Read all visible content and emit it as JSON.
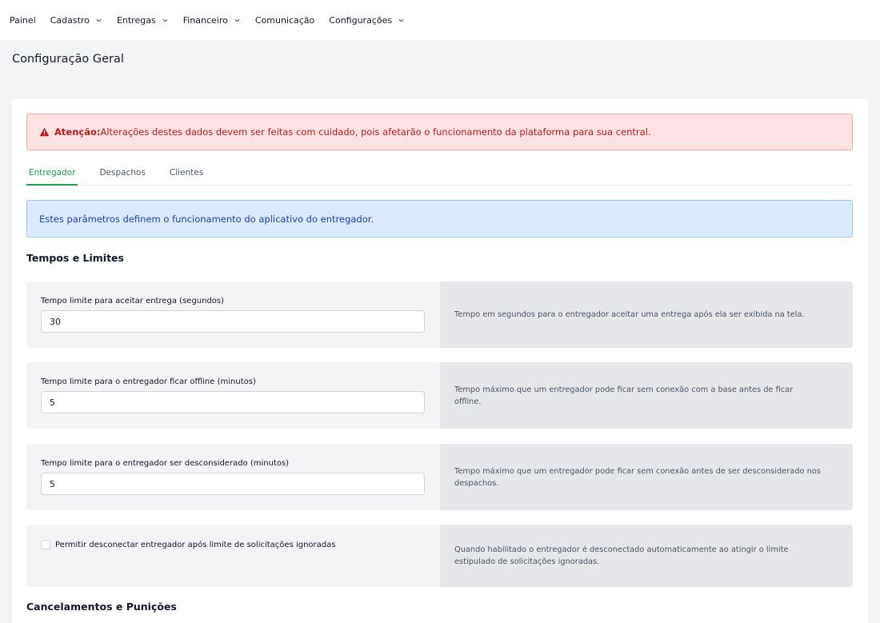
{
  "nav": {
    "items": [
      {
        "label": "Painel",
        "has_dropdown": false
      },
      {
        "label": "Cadastro",
        "has_dropdown": true
      },
      {
        "label": "Entregas",
        "has_dropdown": true
      },
      {
        "label": "Financeiro",
        "has_dropdown": true
      },
      {
        "label": "Comunicação",
        "has_dropdown": false
      },
      {
        "label": "Configurações",
        "has_dropdown": true
      }
    ]
  },
  "page": {
    "title": "Configuração Geral"
  },
  "alert": {
    "strong": "Atenção:",
    "text": "Alterações destes dados devem ser feitas com cuidado, pois afetarão o funcionamento da plataforma para sua central.",
    "icon": "warning-triangle-icon",
    "color": "#b91c1c"
  },
  "tabs": [
    {
      "label": "Entregador",
      "active": true
    },
    {
      "label": "Despachos",
      "active": false
    },
    {
      "label": "Clientes",
      "active": false
    }
  ],
  "info": {
    "text": "Estes parâmetros definem o funcionamento do aplicativo do entregador."
  },
  "sections": {
    "limits_title": "Tempos e Limites",
    "cancel_title": "Cancelamentos e Punições"
  },
  "fields": [
    {
      "label": "Tempo limite para aceitar entrega (segundos)",
      "value": "30",
      "help": "Tempo em segundos para o entregador aceitar uma entrega após ela ser exibida na tela."
    },
    {
      "label": "Tempo limite para o entregador ficar offline (minutos)",
      "value": "5",
      "help": "Tempo máximo que um entregador pode ficar sem conexão com a base antes de ficar offline."
    },
    {
      "label": "Tempo limite para o entregador ser desconsiderado (minutos)",
      "value": "5",
      "help": "Tempo máximo que um entregador pode ficar sem conexão antes de ser desconsiderado nos despachos."
    }
  ],
  "checkbox": {
    "label": "Permitir desconectar entregador após limite de solicitações ignoradas",
    "checked": false,
    "help": "Quando habilitado o entregador é desconectado automaticamente ao atingir o limite estipulado de solicitações ignoradas."
  },
  "colors": {
    "accent": "#16a34a",
    "info": "#1e40af",
    "danger": "#b91c1c"
  }
}
